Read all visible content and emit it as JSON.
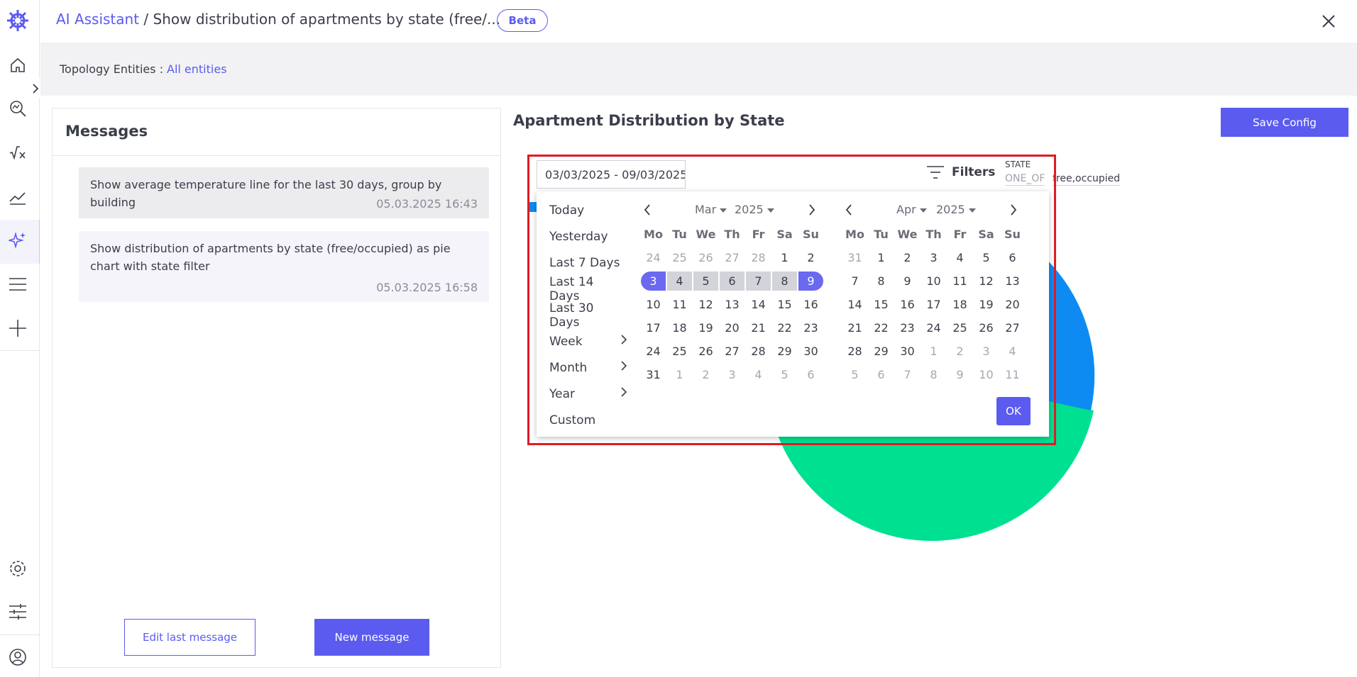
{
  "header": {
    "breadcrumb_link": "AI Assistant",
    "breadcrumb_sep": " / ",
    "breadcrumb_current": "Show distribution of apartments by state (free/...",
    "badge": "Beta"
  },
  "topology": {
    "label": "Topology Entities :",
    "value": "All entities"
  },
  "messages": {
    "title": "Messages",
    "items": [
      {
        "text": "Show average temperature line for the last 30 days, group by building",
        "time": "05.03.2025 16:43"
      },
      {
        "text": "Show distribution of apartments by state (free/occupied) as pie chart with state filter",
        "time": "05.03.2025 16:58"
      }
    ],
    "edit_label": "Edit last message",
    "new_label": "New message"
  },
  "panel": {
    "title": "Apartment Distribution by State",
    "save_label": "Save Config",
    "date_range": "03/03/2025 - 09/03/2025",
    "filters_label": "Filters",
    "filter": {
      "field": "STATE",
      "operator": "ONE_OF",
      "value": "free,occupied"
    }
  },
  "picker": {
    "presets": [
      {
        "label": "Today",
        "submenu": false
      },
      {
        "label": "Yesterday",
        "submenu": false
      },
      {
        "label": "Last 7 Days",
        "submenu": false
      },
      {
        "label": "Last 14 Days",
        "submenu": false
      },
      {
        "label": "Last 30 Days",
        "submenu": false
      },
      {
        "label": "Week",
        "submenu": true
      },
      {
        "label": "Month",
        "submenu": true
      },
      {
        "label": "Year",
        "submenu": true
      },
      {
        "label": "Custom",
        "submenu": false
      }
    ],
    "weekdays": [
      "Mo",
      "Tu",
      "We",
      "Th",
      "Fr",
      "Sa",
      "Su"
    ],
    "left": {
      "month": "Mar",
      "year": "2025",
      "days": [
        [
          "24",
          "out"
        ],
        [
          "25",
          "out"
        ],
        [
          "26",
          "out"
        ],
        [
          "27",
          "out"
        ],
        [
          "28",
          "out"
        ],
        [
          "1",
          ""
        ],
        [
          "2",
          ""
        ],
        [
          "3",
          "sel-start"
        ],
        [
          "4",
          "in-range"
        ],
        [
          "5",
          "in-range"
        ],
        [
          "6",
          "in-range"
        ],
        [
          "7",
          "in-range"
        ],
        [
          "8",
          "in-range"
        ],
        [
          "9",
          "sel-end"
        ],
        [
          "10",
          ""
        ],
        [
          "11",
          ""
        ],
        [
          "12",
          ""
        ],
        [
          "13",
          ""
        ],
        [
          "14",
          ""
        ],
        [
          "15",
          ""
        ],
        [
          "16",
          ""
        ],
        [
          "17",
          ""
        ],
        [
          "18",
          ""
        ],
        [
          "19",
          ""
        ],
        [
          "20",
          ""
        ],
        [
          "21",
          ""
        ],
        [
          "22",
          ""
        ],
        [
          "23",
          ""
        ],
        [
          "24",
          ""
        ],
        [
          "25",
          ""
        ],
        [
          "26",
          ""
        ],
        [
          "27",
          ""
        ],
        [
          "28",
          ""
        ],
        [
          "29",
          ""
        ],
        [
          "30",
          ""
        ],
        [
          "31",
          ""
        ],
        [
          "1",
          "out"
        ],
        [
          "2",
          "out"
        ],
        [
          "3",
          "out"
        ],
        [
          "4",
          "out"
        ],
        [
          "5",
          "out"
        ],
        [
          "6",
          "out"
        ]
      ]
    },
    "right": {
      "month": "Apr",
      "year": "2025",
      "days": [
        [
          "31",
          "out"
        ],
        [
          "1",
          ""
        ],
        [
          "2",
          ""
        ],
        [
          "3",
          ""
        ],
        [
          "4",
          ""
        ],
        [
          "5",
          ""
        ],
        [
          "6",
          ""
        ],
        [
          "7",
          ""
        ],
        [
          "8",
          ""
        ],
        [
          "9",
          ""
        ],
        [
          "10",
          ""
        ],
        [
          "11",
          ""
        ],
        [
          "12",
          ""
        ],
        [
          "13",
          ""
        ],
        [
          "14",
          ""
        ],
        [
          "15",
          ""
        ],
        [
          "16",
          ""
        ],
        [
          "17",
          ""
        ],
        [
          "18",
          ""
        ],
        [
          "19",
          ""
        ],
        [
          "20",
          ""
        ],
        [
          "21",
          ""
        ],
        [
          "22",
          ""
        ],
        [
          "23",
          ""
        ],
        [
          "24",
          ""
        ],
        [
          "25",
          ""
        ],
        [
          "26",
          ""
        ],
        [
          "27",
          ""
        ],
        [
          "28",
          ""
        ],
        [
          "29",
          ""
        ],
        [
          "30",
          ""
        ],
        [
          "1",
          "out"
        ],
        [
          "2",
          "out"
        ],
        [
          "3",
          "out"
        ],
        [
          "4",
          "out"
        ],
        [
          "5",
          "out"
        ],
        [
          "6",
          "out"
        ],
        [
          "7",
          "out"
        ],
        [
          "8",
          "out"
        ],
        [
          "9",
          "out"
        ],
        [
          "10",
          "out"
        ],
        [
          "11",
          "out"
        ]
      ]
    },
    "ok_label": "OK"
  },
  "colors": {
    "accent": "#5b5bf0",
    "pie_free": "#0d8bf2",
    "pie_occupied": "#00e091",
    "highlight": "#e01b24"
  }
}
